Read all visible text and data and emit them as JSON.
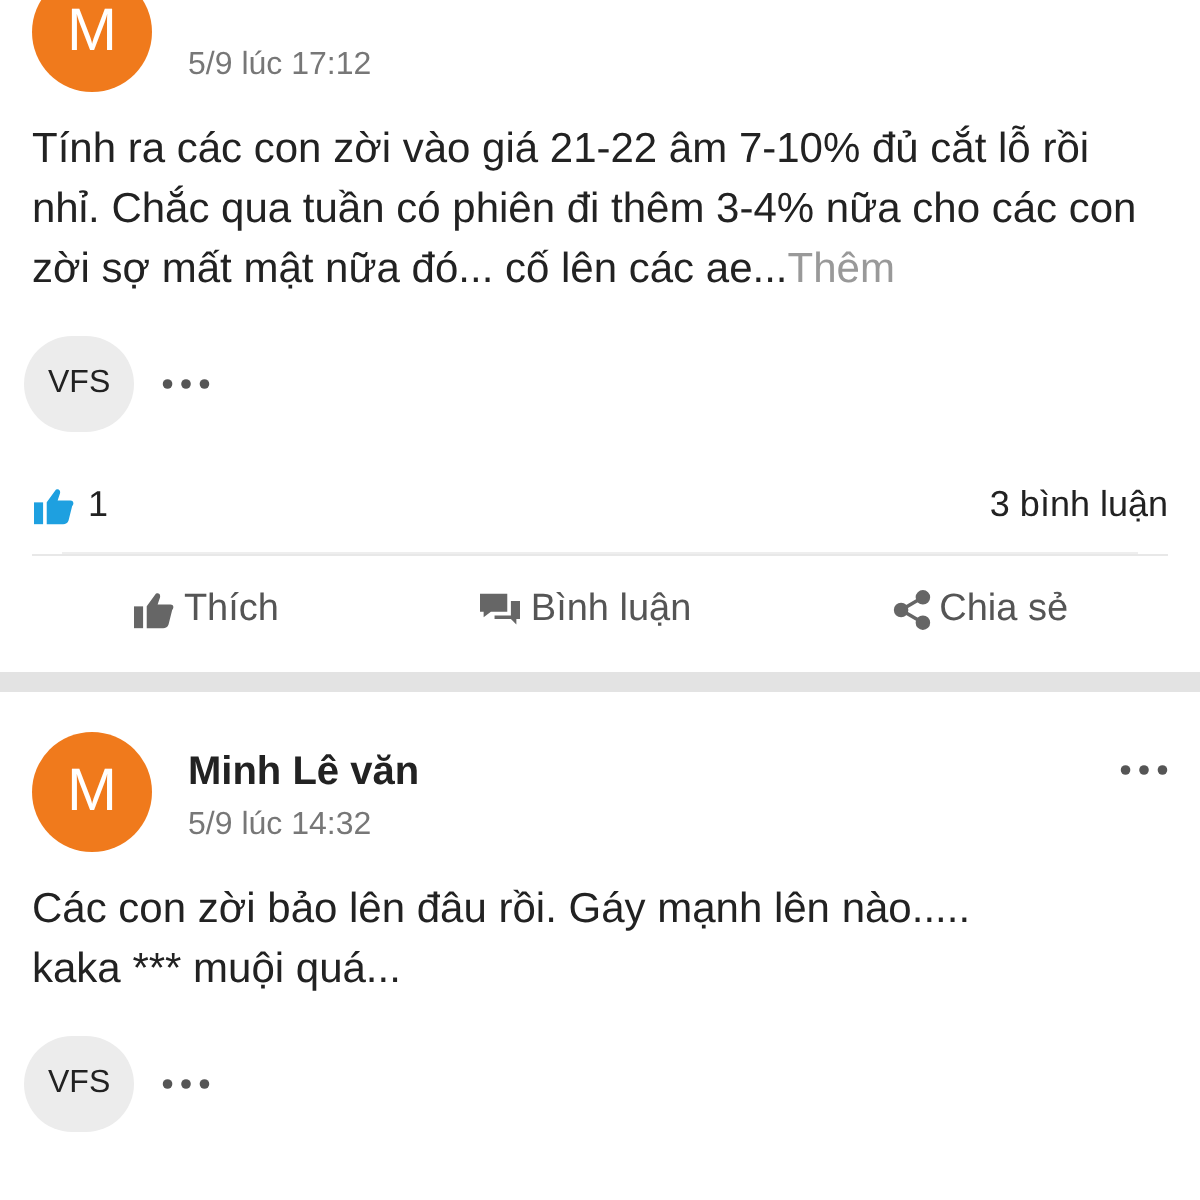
{
  "posts": [
    {
      "avatar": "M",
      "time": "5/9 lúc 17:12",
      "body": "Tính ra các con zời vào giá 21-22 âm 7-10% đủ cắt lỗ rồi nhỉ. Chắc qua tuần có phiên đi thêm 3-4% nữa cho các con zời sợ mất mật nữa đó... cố lên các ae...",
      "more": "Thêm",
      "tag": "VFS",
      "likes": "1",
      "comments": "3 bình luận",
      "actions": [
        {
          "kind": "like",
          "label": "Thích"
        },
        {
          "kind": "comment",
          "label": "Bình luận"
        },
        {
          "kind": "share",
          "label": "Chia sẻ"
        }
      ]
    },
    {
      "avatar": "M",
      "name": "Minh Lê văn",
      "time": "5/9 lúc 14:32",
      "body": "Các con zời bảo lên đâu rồi. Gáy mạnh lên nào.....\nkaka *** muội quá...",
      "tag": "VFS"
    }
  ]
}
